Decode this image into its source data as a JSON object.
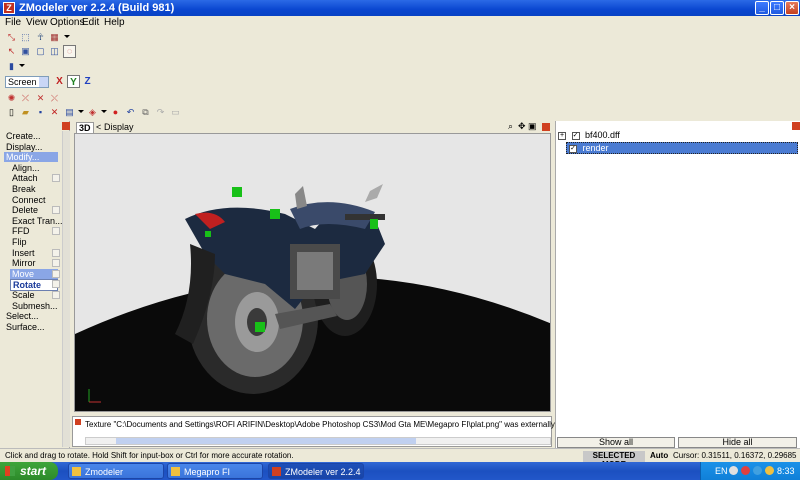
{
  "window": {
    "title": "ZModeler ver 2.2.4 (Build 981)"
  },
  "menu": [
    "File",
    "View",
    "Options",
    "Edit",
    "Help"
  ],
  "axis_toolbar": {
    "space": "Screen",
    "x": "X",
    "y": "Y",
    "z": "Z"
  },
  "left_panel": {
    "items": [
      {
        "label": "Create...",
        "kind": "cmd"
      },
      {
        "label": "Display...",
        "kind": "cmd"
      },
      {
        "label": "Modify...",
        "kind": "cmd",
        "state": "highlight"
      },
      {
        "label": "Align...",
        "kind": "sub"
      },
      {
        "label": "Attach",
        "kind": "sub",
        "options": true
      },
      {
        "label": "Break",
        "kind": "sub"
      },
      {
        "label": "Connect",
        "kind": "sub"
      },
      {
        "label": "Delete",
        "kind": "sub",
        "options": true
      },
      {
        "label": "Exact Tran...",
        "kind": "sub"
      },
      {
        "label": "FFD",
        "kind": "sub",
        "options": true
      },
      {
        "label": "Flip",
        "kind": "sub"
      },
      {
        "label": "Insert",
        "kind": "sub",
        "options": true
      },
      {
        "label": "Mirror",
        "kind": "sub",
        "options": true
      },
      {
        "label": "Move",
        "kind": "sub",
        "state": "highlight",
        "options": true
      },
      {
        "label": "Rotate",
        "kind": "sub",
        "state": "selected",
        "options": true
      },
      {
        "label": "Scale",
        "kind": "sub",
        "options": true
      },
      {
        "label": "Submesh...",
        "kind": "sub"
      },
      {
        "label": "Select...",
        "kind": "cmd"
      },
      {
        "label": "Surface...",
        "kind": "cmd"
      }
    ]
  },
  "viewport": {
    "mode": "3D",
    "nav_back": "<",
    "display_label": "Display"
  },
  "log": {
    "text": "Texture \"C:\\Documents and Settings\\ROFI ARIFIN\\Desktop\\Adobe Photoshop CS3\\Mod Gta ME\\Megapro FI\\plat.png\" was externally modified and reloa"
  },
  "scene_tree": {
    "items": [
      {
        "label": "bf400.dff",
        "expander": "+",
        "checked": true
      },
      {
        "label": "render",
        "checked": true,
        "selected": true
      }
    ],
    "show_all": "Show all",
    "hide_all": "Hide all"
  },
  "status": {
    "message": "Click and drag to rotate. Hold Shift for input-box or Ctrl for more accurate rotation.",
    "mode": "SELECTED MODE",
    "auto": "Auto",
    "cursor": "Cursor: 0.31511, 0.16372, 0.29685"
  },
  "taskbar": {
    "start": "start",
    "tasks": [
      {
        "label": "Zmodeler"
      },
      {
        "label": "Megapro FI"
      },
      {
        "label": "ZModeler ver 2.2.4 (...",
        "active": true
      }
    ],
    "lang": "EN",
    "clock": "8:33"
  },
  "colors": {
    "title_blue": "#0a46d0",
    "taskbar_blue": "#2257c9",
    "start_green": "#3ea53a",
    "selection": "#8aa6e6"
  }
}
